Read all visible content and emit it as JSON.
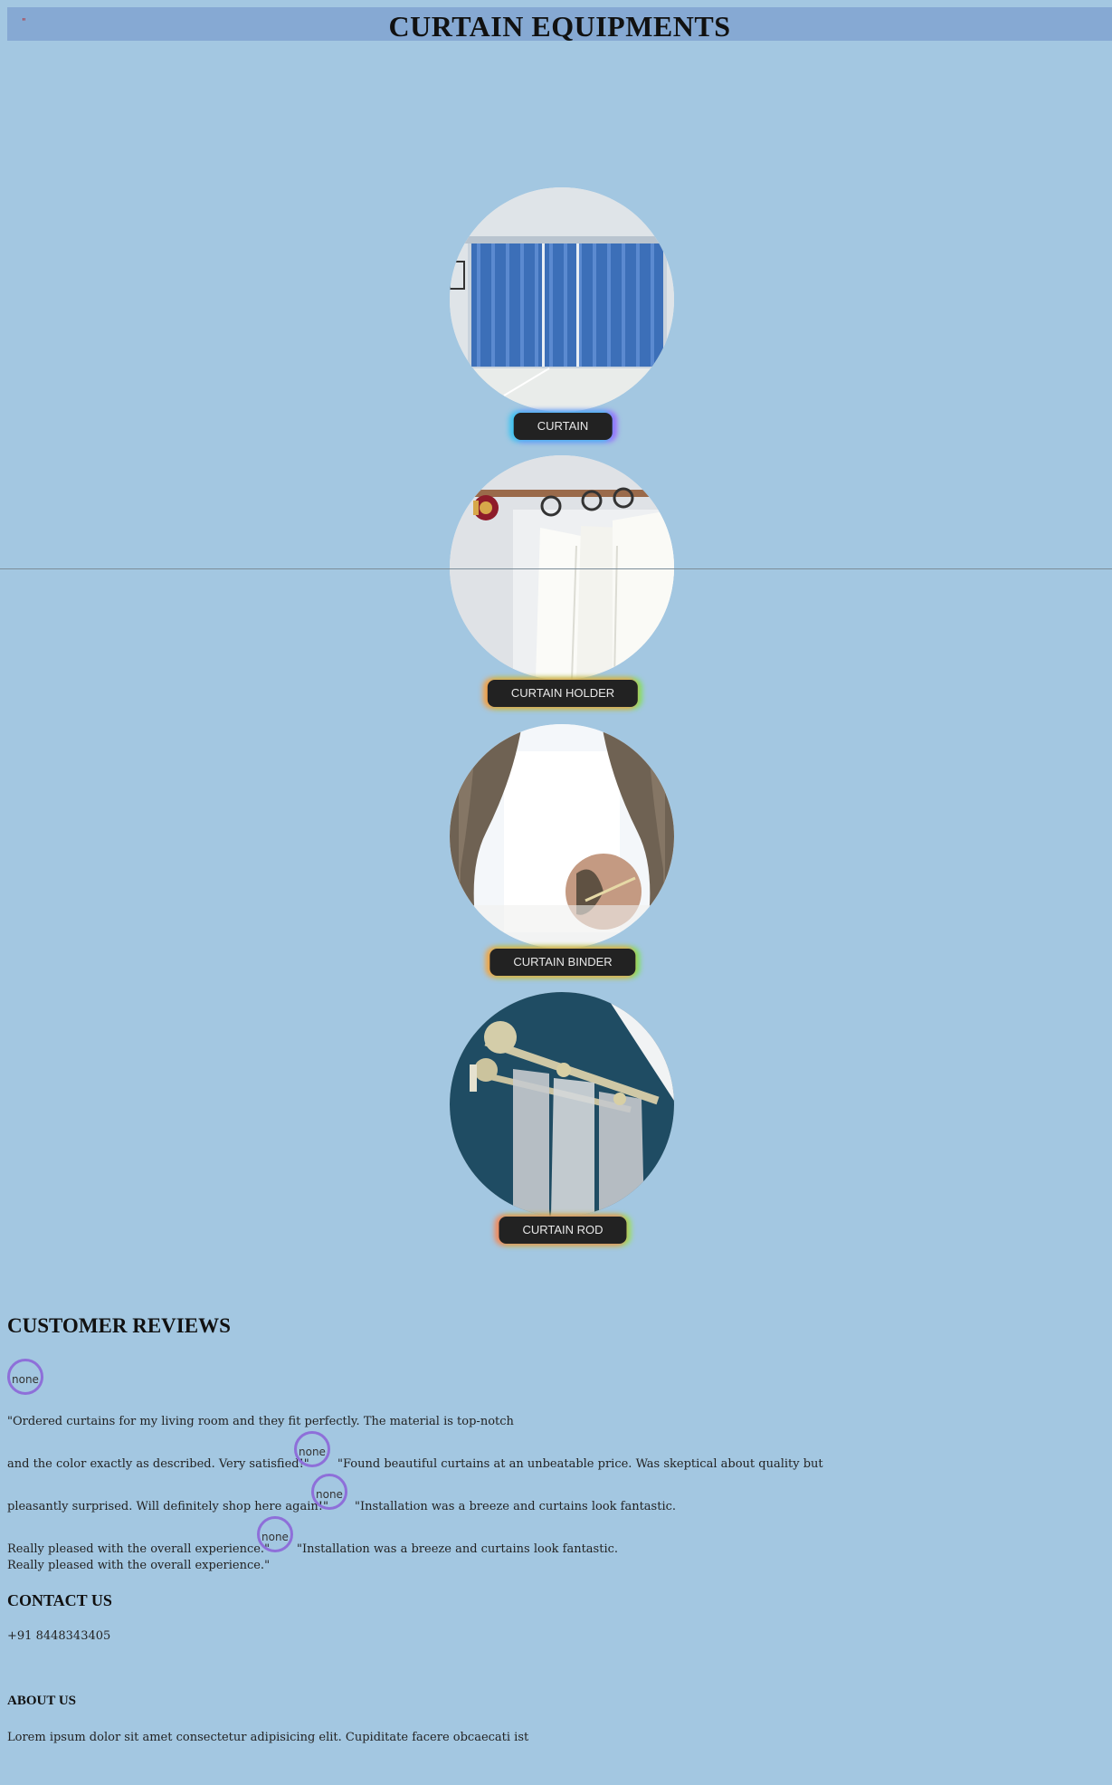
{
  "header": {
    "title": "CURTAIN EQUIPMENTS",
    "mark": "\""
  },
  "products": [
    {
      "label": "CURTAIN"
    },
    {
      "label": "CURTAIN HOLDER"
    },
    {
      "label": "CURTAIN BINDER"
    },
    {
      "label": "CURTAIN ROD"
    }
  ],
  "reviews": {
    "title": "CUSTOMER REVIEWS",
    "avatar_alt": "none",
    "lines": [
      "\"Ordered curtains for my living room and they fit perfectly. The material is top-notch",
      "and the color exactly as described. Very satisfied!\"",
      "\"Found beautiful curtains at an unbeatable price. Was skeptical about quality but",
      "pleasantly surprised. Will definitely shop here again!\"",
      "\"Installation was a breeze and curtains look fantastic.",
      "Really pleased with the overall experience.\"",
      "\"Installation was a breeze and curtains look fantastic.",
      "Really pleased with the overall experience.\""
    ]
  },
  "contact": {
    "title": "CONTACT US",
    "phone": "+91 8448343405"
  },
  "about": {
    "title": "ABOUT US",
    "text": "Lorem ipsum dolor sit amet consectetur adipisicing elit. Cupiditate facere obcaecati ist"
  },
  "colors": {
    "page_bg": "#a3c7e1",
    "header_bg": "#86a9d3",
    "button_bg": "#222222",
    "avatar_ring": "#8e6fd9"
  }
}
